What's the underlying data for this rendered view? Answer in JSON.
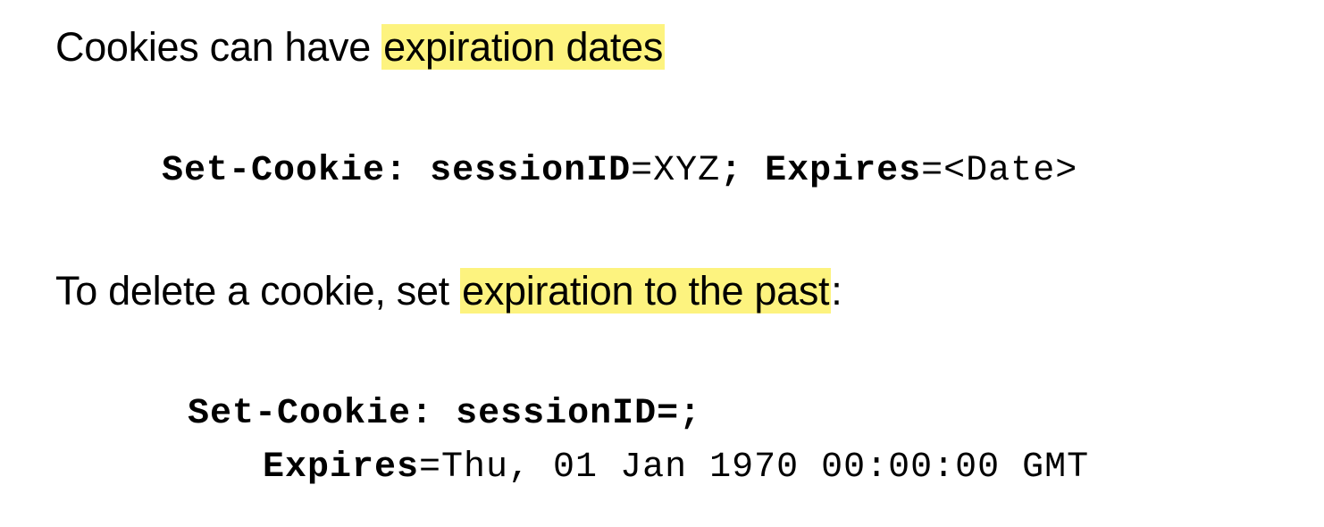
{
  "section1": {
    "lead": "Cookies can have ",
    "highlight": "expiration dates",
    "code": {
      "key1": "Set-Cookie:",
      "space1": " ",
      "key2": "sessionID",
      "val2": "=XYZ",
      "sep": "; ",
      "key3": "Expires",
      "val3": "=<Date>"
    }
  },
  "section2": {
    "lead": "To delete a cookie, set ",
    "highlight": "expiration to the past",
    "trail": ":",
    "code_line1": {
      "key1": "Set-Cookie:",
      "space1": " ",
      "key2": "sessionID=;"
    },
    "code_line2": {
      "key": "Expires",
      "val": "=Thu, 01 Jan 1970 00:00:00 GMT"
    }
  },
  "colors": {
    "highlight": "#fdf37f",
    "text": "#000000",
    "background": "#ffffff"
  }
}
